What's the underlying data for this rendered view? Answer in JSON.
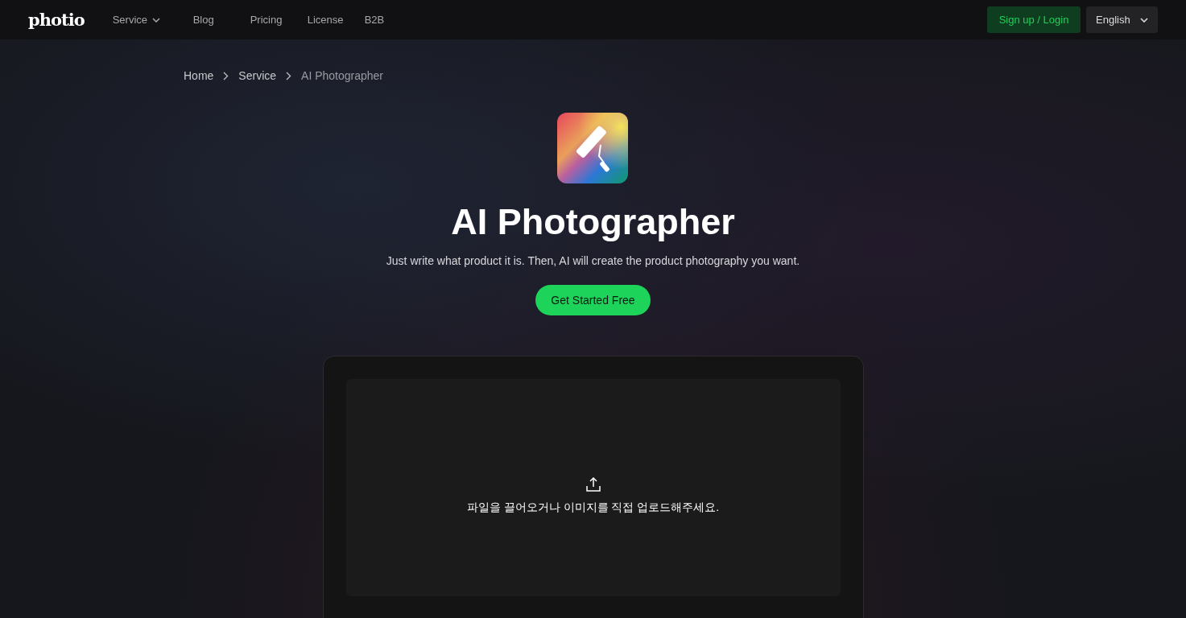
{
  "nav": {
    "logo": "photio",
    "items": [
      {
        "label": "Service",
        "dropdown": true
      },
      {
        "label": "Blog",
        "dropdown": false
      },
      {
        "label": "Pricing",
        "dropdown": false
      },
      {
        "label": "License",
        "dropdown": false
      },
      {
        "label": "B2B",
        "dropdown": false
      }
    ],
    "login": "Sign up / Login",
    "language": "English"
  },
  "breadcrumb": [
    "Home",
    "Service",
    "AI Photographer"
  ],
  "hero": {
    "title": "AI Photographer",
    "subtitle": "Just write what product it is. Then, AI will create the product photography you want.",
    "cta": "Get Started Free"
  },
  "upload": {
    "text": "파일을 끌어오거나 이미지를 직접 업로드해주세요."
  }
}
